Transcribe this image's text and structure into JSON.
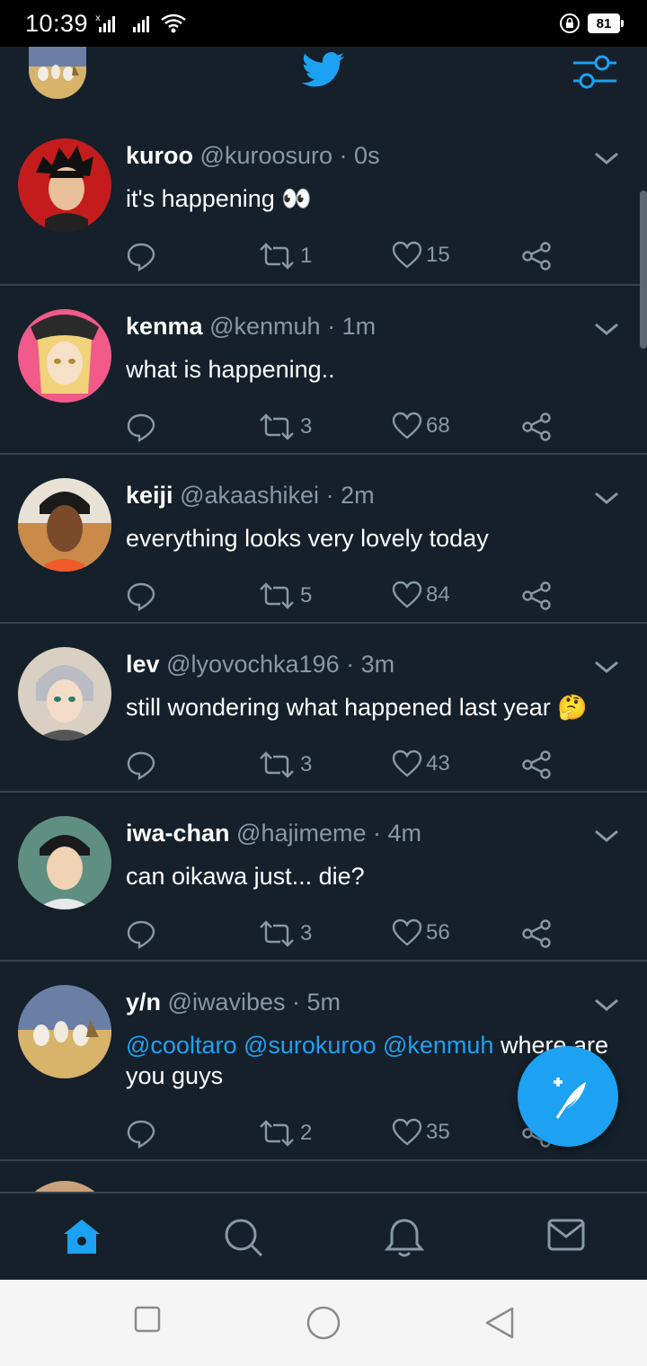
{
  "status_bar": {
    "time": "10:39",
    "battery": "81"
  },
  "app_bar": {
    "logo_icon": "twitter-bird-icon",
    "filter_icon": "sliders-icon"
  },
  "colors": {
    "background": "#15202b",
    "accent": "#1da1f2",
    "divider": "#38444d",
    "secondary_text": "#8899a6"
  },
  "tweets": [
    {
      "name": "kuroo",
      "handle": "@kuroosuro",
      "dot": "·",
      "time": "0s",
      "text": "it's happening 👀",
      "retweets": "1",
      "likes": "15"
    },
    {
      "name": "kenma",
      "handle": "@kenmuh",
      "dot": "·",
      "time": "1m",
      "text": "what is happening..",
      "retweets": "3",
      "likes": "68"
    },
    {
      "name": "keiji",
      "handle": "@akaashikei",
      "dot": "·",
      "time": "2m",
      "text": "everything looks very lovely today",
      "retweets": "5",
      "likes": "84"
    },
    {
      "name": "lev",
      "handle": "@lyovochka196",
      "dot": "·",
      "time": "3m",
      "text": "still wondering what happened last year 🤔",
      "retweets": "3",
      "likes": "43"
    },
    {
      "name": "iwa-chan",
      "handle": "@hajimeme",
      "dot": "·",
      "time": "4m",
      "text": "can oikawa just... die?",
      "retweets": "3",
      "likes": "56"
    },
    {
      "name": "y/n",
      "handle": "@iwavibes",
      "dot": "·",
      "time": "5m",
      "mentions": [
        "@cooltaro",
        "@surokuroo",
        "@kenmuh"
      ],
      "text": "where are you guys",
      "retweets": "2",
      "likes": "35"
    }
  ],
  "bottom_nav": {
    "items": [
      "home-icon",
      "search-icon",
      "bell-icon",
      "mail-icon"
    ]
  }
}
